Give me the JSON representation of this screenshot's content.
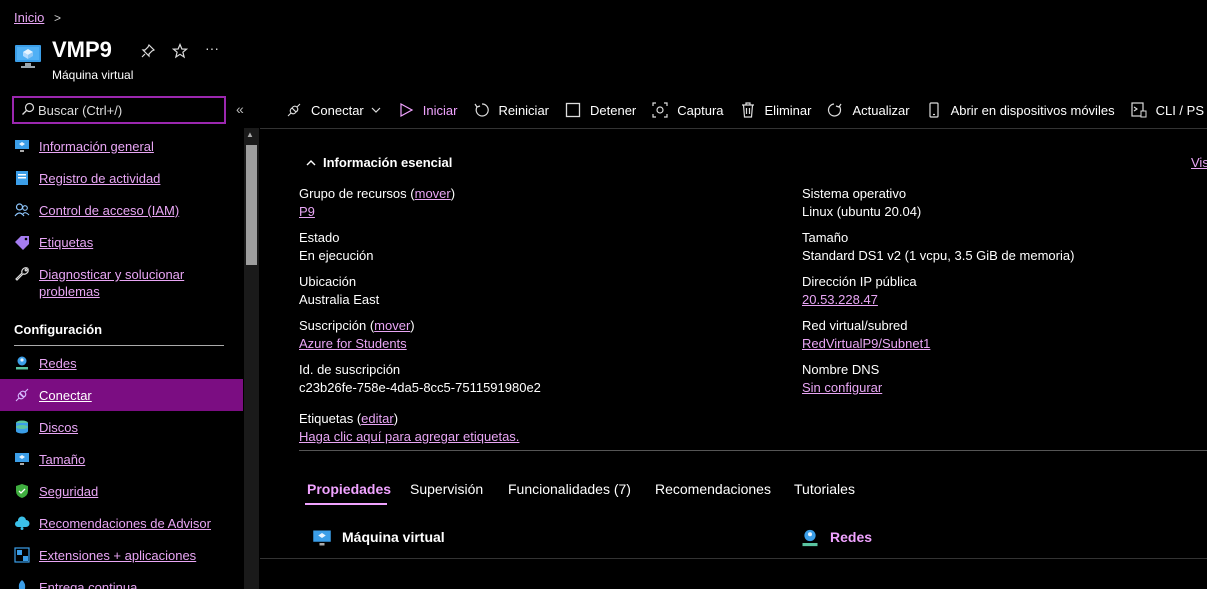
{
  "breadcrumb": {
    "home": "Inicio"
  },
  "header": {
    "title": "VMP9",
    "subtitle": "Máquina virtual",
    "more": "···"
  },
  "search": {
    "placeholder": "Buscar (Ctrl+/)"
  },
  "sidebar": {
    "items": [
      {
        "label": "Información general",
        "icon": "monitor-icon"
      },
      {
        "label": "Registro de actividad",
        "icon": "log-icon"
      },
      {
        "label": "Control de acceso (IAM)",
        "icon": "people-icon"
      },
      {
        "label": "Etiquetas",
        "icon": "tag-icon"
      },
      {
        "label": "Diagnosticar y solucionar problemas",
        "icon": "wrench-icon"
      }
    ],
    "section": "Configuración",
    "config_items": [
      {
        "label": "Redes",
        "icon": "network-icon"
      },
      {
        "label": "Conectar",
        "icon": "plug-icon"
      },
      {
        "label": "Discos",
        "icon": "disk-icon"
      },
      {
        "label": "Tamaño",
        "icon": "monitor-icon"
      },
      {
        "label": "Seguridad",
        "icon": "shield-icon"
      },
      {
        "label": "Recomendaciones de Advisor",
        "icon": "cloud-icon"
      },
      {
        "label": "Extensiones + aplicaciones",
        "icon": "extension-icon"
      },
      {
        "label": "Entrega continua",
        "icon": "rocket-icon"
      }
    ]
  },
  "toolbar": {
    "connect": "Conectar",
    "start": "Iniciar",
    "restart": "Reiniciar",
    "stop": "Detener",
    "capture": "Captura",
    "delete": "Eliminar",
    "refresh": "Actualizar",
    "mobile": "Abrir en dispositivos móviles",
    "cli": "CLI / PS"
  },
  "essentials": {
    "header": "Información esencial",
    "view_link": "Vis",
    "left": {
      "resource_group_label": "Grupo de recursos",
      "move": "mover",
      "resource_group_value": "P9",
      "status_label": "Estado",
      "status_value": "En ejecución",
      "location_label": "Ubicación",
      "location_value": "Australia East",
      "subscription_label": "Suscripción",
      "subscription_value": "Azure for Students",
      "subscription_id_label": "Id. de suscripción",
      "subscription_id_value": "c23b26fe-758e-4da5-8cc5-7511591980e2",
      "tags_label": "Etiquetas",
      "edit": "editar",
      "tags_value": "Haga clic aquí para agregar etiquetas."
    },
    "right": {
      "os_label": "Sistema operativo",
      "os_value": "Linux (ubuntu 20.04)",
      "size_label": "Tamaño",
      "size_value": "Standard DS1 v2 (1 vcpu, 3.5 GiB de memoria)",
      "public_ip_label": "Dirección IP pública",
      "public_ip_value": "20.53.228.47",
      "vnet_label": "Red virtual/subred",
      "vnet_value": "RedVirtualP9/Subnet1",
      "dns_label": "Nombre DNS",
      "dns_value": "Sin configurar"
    }
  },
  "tabs": [
    "Propiedades",
    "Supervisión",
    "Funcionalidades (7)",
    "Recomendaciones",
    "Tutoriales"
  ],
  "properties": {
    "vm_title": "Máquina virtual",
    "network_title": "Redes"
  },
  "colors": {
    "accent": "#f0a3ff",
    "link": "#e9a6f5",
    "active_bg": "#7b0d82",
    "search_border": "#9b27af"
  }
}
